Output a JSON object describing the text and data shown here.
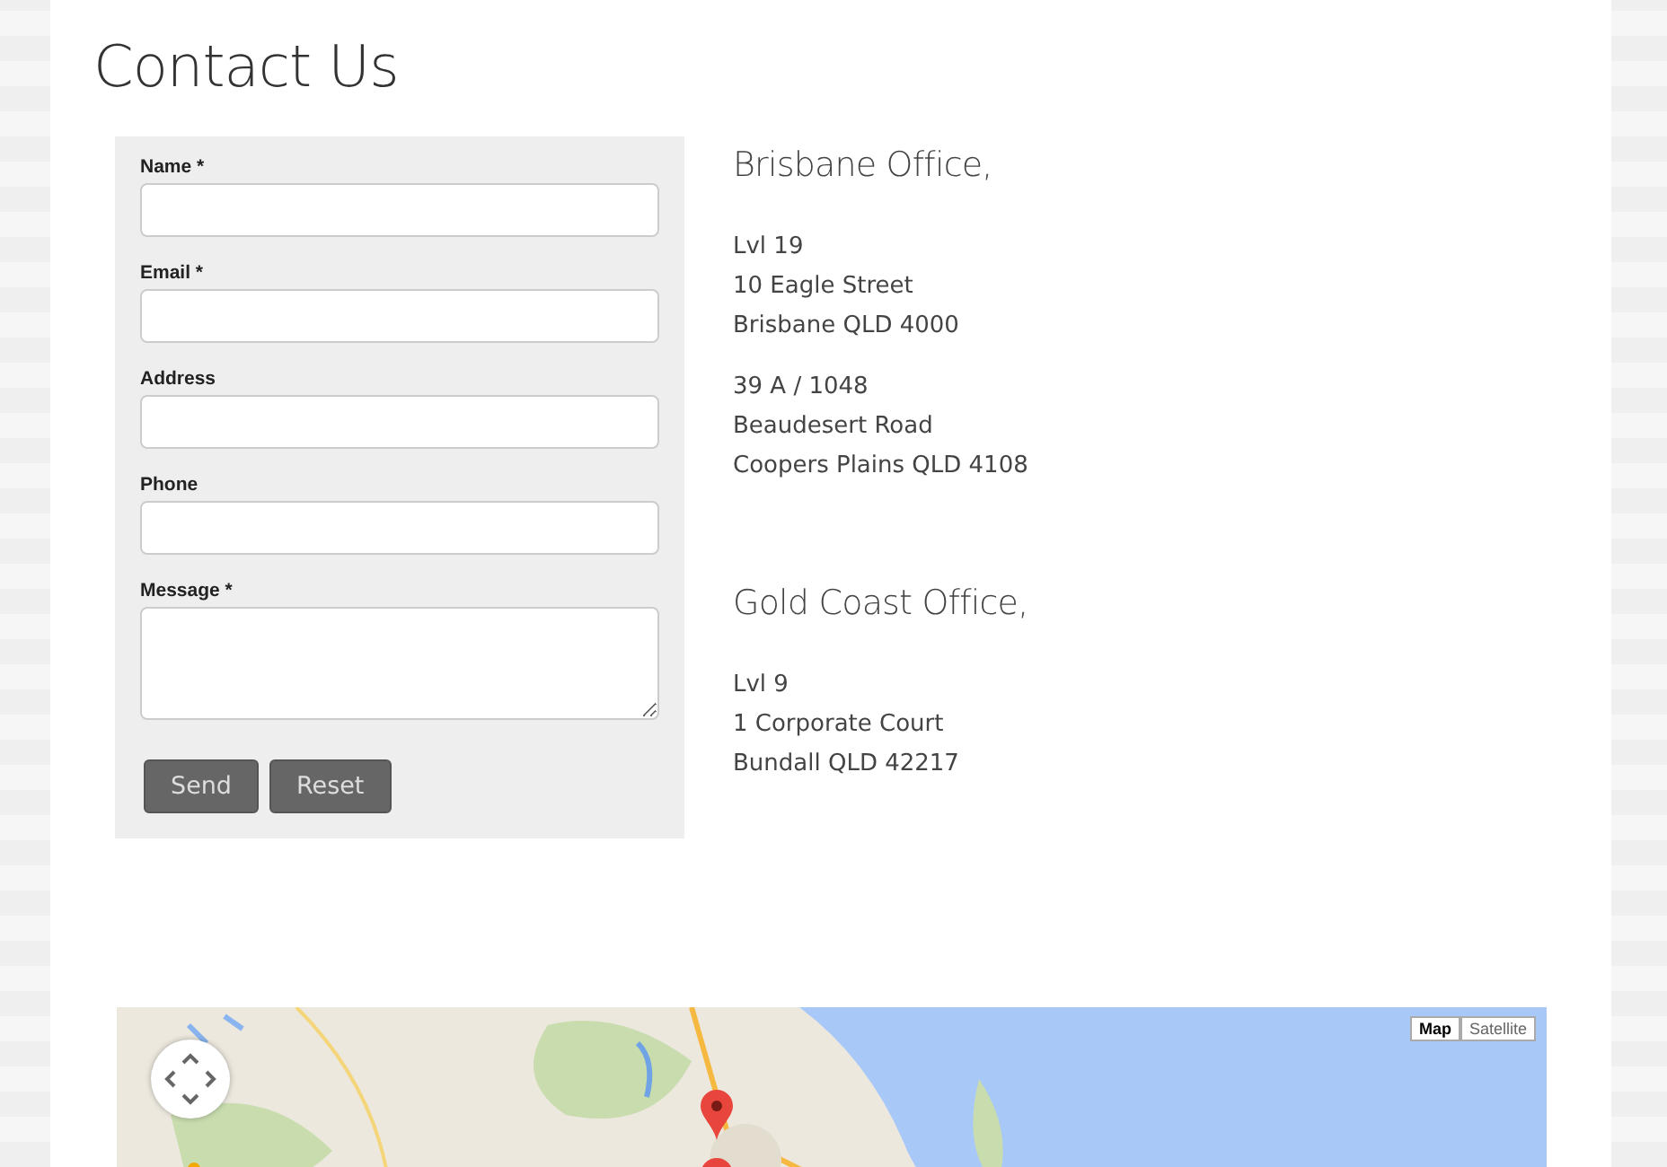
{
  "page_title": "Contact Us",
  "form": {
    "fields": [
      {
        "label": "Name *",
        "kind": "text"
      },
      {
        "label": "Email *",
        "kind": "text"
      },
      {
        "label": "Address",
        "kind": "text"
      },
      {
        "label": "Phone",
        "kind": "text"
      },
      {
        "label": "Message *",
        "kind": "textarea"
      }
    ],
    "buttons": [
      "Send",
      "Reset"
    ]
  },
  "offices": [
    {
      "heading": "Brisbane Office,",
      "addresses": [
        [
          "Lvl 19",
          "10 Eagle Street",
          "Brisbane QLD 4000"
        ],
        [
          "39 A /  1048",
          "Beaudesert Road",
          "Coopers Plains QLD 4108"
        ]
      ]
    },
    {
      "heading": "Gold Coast Office,",
      "addresses": [
        [
          "Lvl 9",
          "1 Corporate Court",
          "Bundall QLD 42217"
        ]
      ]
    }
  ],
  "map": {
    "kind": "picture",
    "map_types": [
      {
        "label": "Map",
        "selected": true
      },
      {
        "label": "Satellite",
        "selected": false
      }
    ]
  }
}
